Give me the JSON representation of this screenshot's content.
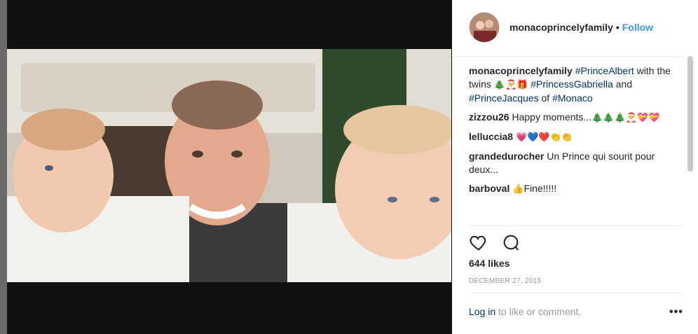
{
  "post": {
    "username": "monacoprincelyfamily",
    "follow_label": "Follow",
    "separator": "•"
  },
  "caption": {
    "username": "monacoprincelyfamily",
    "tag1": "#PrinceAlbert",
    "text1": "with the twins",
    "emojis1": "🎄🎅🎁",
    "tag2": "#PrincessGabriella",
    "text2": "and",
    "tag3": "#PrinceJacques",
    "text3": "of",
    "tag4": "#Monaco"
  },
  "comments": [
    {
      "user": "zizzou26",
      "text": "Happy moments...",
      "emojis": "🎄🎄🎄🎅💝💝"
    },
    {
      "user": "lelluccia8",
      "text": "",
      "emojis": "💗💙❤️👏👏"
    },
    {
      "user": "grandedurocher",
      "text": "Un Prince qui sourit pour deux...",
      "emojis": ""
    },
    {
      "user": "barboval",
      "text": "Fine!!!!!",
      "emojis": "👍"
    }
  ],
  "actions": {
    "like_icon": "heart-icon",
    "comment_icon": "comment-icon"
  },
  "likes_text": "644 likes",
  "date": "DECEMBER 27, 2015",
  "footer": {
    "login_link": "Log in",
    "login_rest": "to like or comment.",
    "more": "•••"
  },
  "colors": {
    "link": "#003569",
    "follow": "#3897f0",
    "text": "#262626",
    "muted": "#999999"
  }
}
